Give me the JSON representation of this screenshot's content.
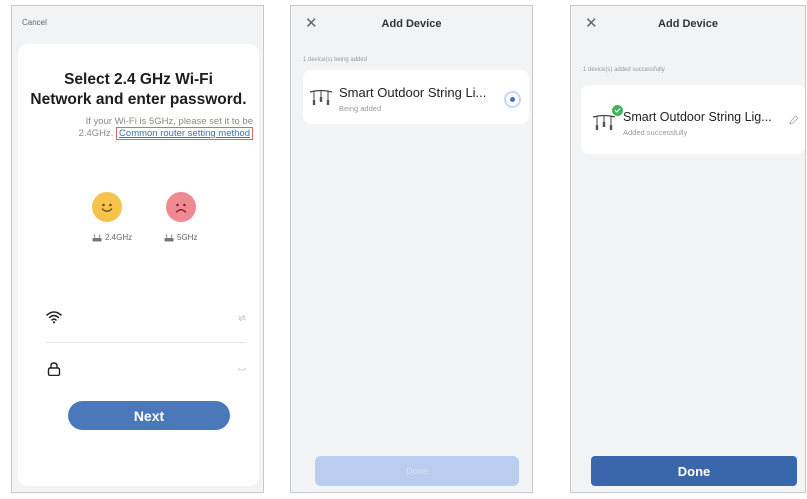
{
  "screen1": {
    "cancel_label": "Cancel",
    "title_line1": "Select 2.4 GHz Wi-Fi",
    "title_line2": "Network and enter password.",
    "hint_line1": "If your Wi-Fi is 5GHz, please set it to be",
    "hint_prefix": "2.4GHz.",
    "hint_link": "Common router setting method",
    "band_ok_label": "2.4GHz",
    "band_bad_label": "5GHz",
    "next_label": "Next",
    "icons": {
      "good": "smiley-face-icon",
      "bad": "sad-face-icon",
      "wifi": "wifi-icon",
      "lock": "lock-icon",
      "router": "router-icon"
    },
    "colors": {
      "accent": "#4a78b9",
      "good": "#f6c34f",
      "bad": "#ef8a93",
      "link_box": "#d96a6a"
    }
  },
  "screen2": {
    "header_title": "Add Device",
    "status_line": "1 device(s) being added",
    "device_name": "Smart Outdoor String Li...",
    "device_status": "Being added",
    "done_label": "Done",
    "icons": {
      "close": "close-icon",
      "device": "string-lights-icon",
      "progress": "progress-spinner-icon"
    },
    "colors": {
      "disabled_button": "#b9cdee",
      "spinner": "#3e74c6"
    }
  },
  "screen3": {
    "header_title": "Add Device",
    "status_line": "1 device(s) added successfully",
    "device_name": "Smart Outdoor String Lig...",
    "device_status": "Added successfully",
    "done_label": "Done",
    "icons": {
      "close": "close-icon",
      "device": "string-lights-icon",
      "success": "check-badge-icon",
      "edit": "edit-pencil-icon"
    },
    "colors": {
      "done_button": "#3a67ab",
      "success": "#44b35a"
    }
  }
}
